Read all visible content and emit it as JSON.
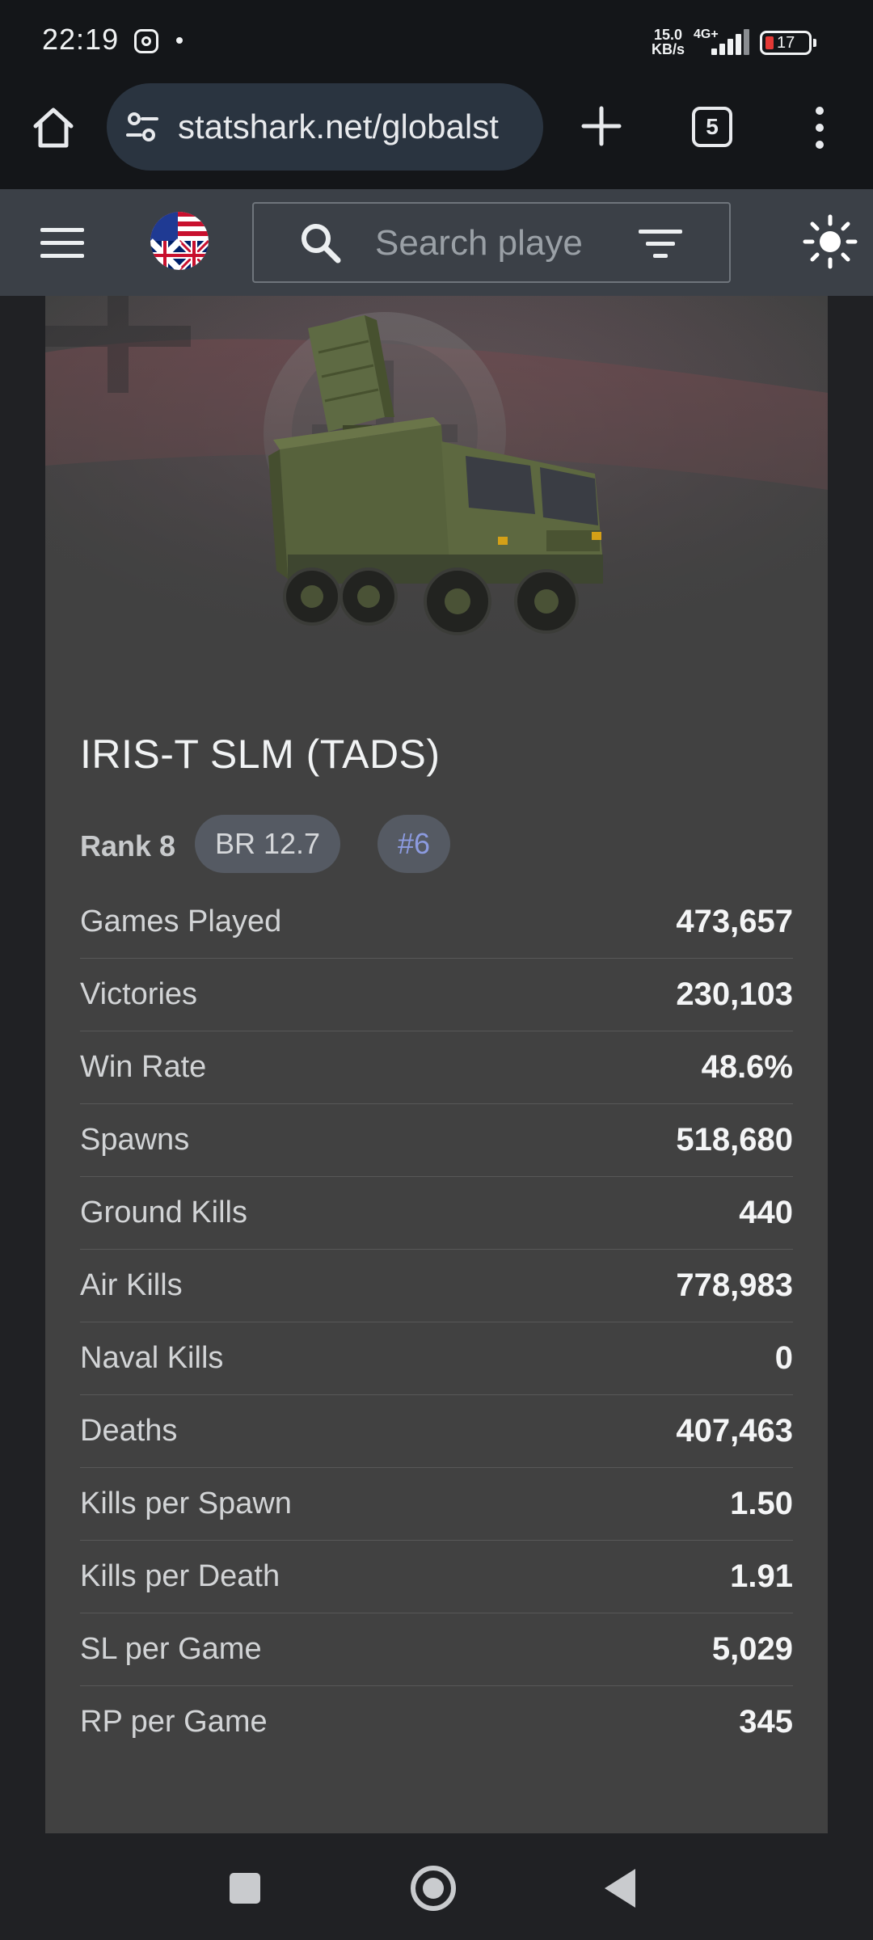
{
  "status_bar": {
    "time": "22:19",
    "speed_value": "15.0",
    "speed_unit": "KB/s",
    "network": "4G+",
    "battery": "17"
  },
  "browser": {
    "url": "statshark.net/globalst",
    "tab_count": "5"
  },
  "site_header": {
    "search_placeholder": "Search playe"
  },
  "vehicle": {
    "name": "IRIS-T SLM (TADS)",
    "rank": "Rank 8",
    "br": "BR 12.7",
    "position": "#6"
  },
  "stats": [
    {
      "label": "Games Played",
      "value": "473,657"
    },
    {
      "label": "Victories",
      "value": "230,103"
    },
    {
      "label": "Win Rate",
      "value": "48.6%"
    },
    {
      "label": "Spawns",
      "value": "518,680"
    },
    {
      "label": "Ground Kills",
      "value": "440"
    },
    {
      "label": "Air Kills",
      "value": "778,983"
    },
    {
      "label": "Naval Kills",
      "value": "0"
    },
    {
      "label": "Deaths",
      "value": "407,463"
    },
    {
      "label": "Kills per Spawn",
      "value": "1.50"
    },
    {
      "label": "Kills per Death",
      "value": "1.91"
    },
    {
      "label": "SL per Game",
      "value": "5,029"
    },
    {
      "label": "RP per Game",
      "value": "345"
    }
  ],
  "colors": {
    "card_bg": "#414141",
    "header_bg": "#3b4047",
    "chip_bg": "#555a63",
    "position_accent": "#8c9be0"
  }
}
